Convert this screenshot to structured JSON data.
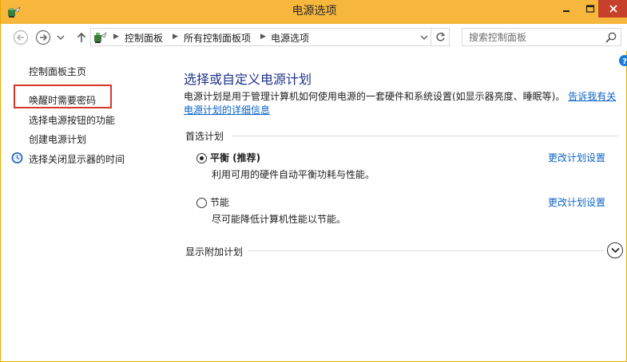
{
  "window": {
    "title": "电源选项"
  },
  "address": {
    "crumbs": [
      "控制面板",
      "所有控制面板项",
      "电源选项"
    ]
  },
  "search": {
    "placeholder": "搜索控制面板"
  },
  "sidebar": {
    "items": [
      {
        "label": "控制面板主页"
      },
      {
        "label": "唤醒时需要密码"
      },
      {
        "label": "选择电源按钮的功能"
      },
      {
        "label": "创建电源计划"
      },
      {
        "label": "选择关闭显示器的时间"
      }
    ],
    "highlight_color": "#d9362b"
  },
  "main": {
    "title": "选择或自定义电源计划",
    "description": "电源计划是用于管理计算机如何使用电源的一套硬件和系统设置(如显示器亮度、睡眠等)。",
    "learn_more_link": "告诉我有关电源计划的详细信息",
    "preferred_group": "首选计划",
    "plans": [
      {
        "name": "平衡 (推荐)",
        "description": "利用可用的硬件自动平衡功耗与性能。",
        "link": "更改计划设置",
        "selected": true
      },
      {
        "name": "节能",
        "description": "尽可能降低计算机性能以节能。",
        "link": "更改计划设置",
        "selected": false
      }
    ],
    "additional_group": "显示附加计划"
  },
  "colors": {
    "titlebar": "#f6b73c",
    "close_button": "#c7402b",
    "heading": "#1e3287",
    "link": "#0a63c7"
  }
}
